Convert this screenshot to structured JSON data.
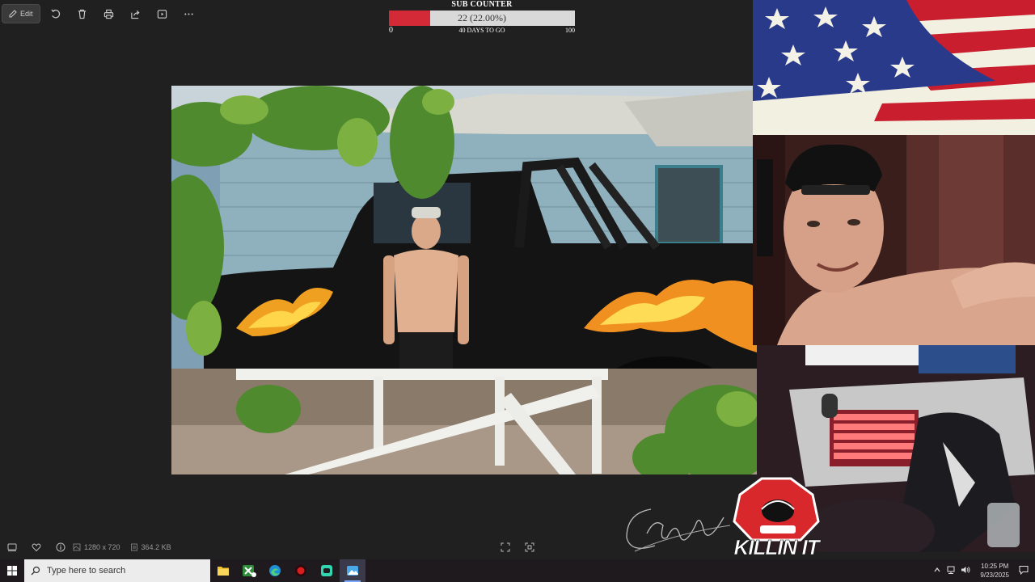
{
  "toolbar": {
    "edit_label": "Edit",
    "icons": [
      "rotate-icon",
      "delete-icon",
      "print-icon",
      "share-icon",
      "slideshow-icon",
      "more-icon"
    ]
  },
  "sub_counter": {
    "title": "SUB COUNTER",
    "progress_text": "22 (22.00%)",
    "current": 22,
    "min": "0",
    "max": "100",
    "days_label": "40 DAYS TO GO",
    "fill_color": "#d42a38"
  },
  "status_bar": {
    "dimensions": "1280 x 720",
    "file_size": "364.2 KB"
  },
  "overlay": {
    "logo_text": "KILLIN IT"
  },
  "taskbar": {
    "search_placeholder": "Type here to search",
    "time": "10:25 PM",
    "date": "9/23/2025",
    "apps": [
      "file-explorer-icon",
      "xbox-icon",
      "edge-icon",
      "record-app-icon",
      "teal-app-icon",
      "photos-icon"
    ]
  },
  "colors": {
    "background": "#202020",
    "taskbar": "#1f1a1e",
    "accent": "#7aa7ff"
  }
}
